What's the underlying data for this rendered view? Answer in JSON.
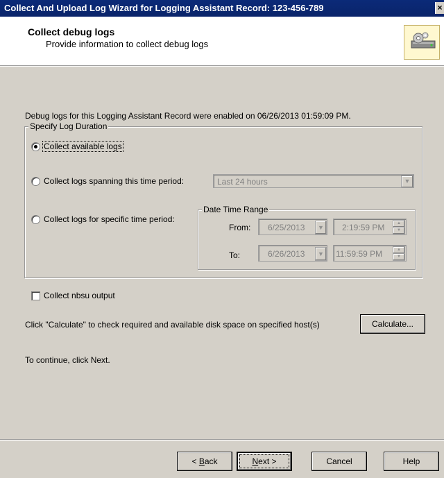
{
  "window": {
    "title": "Collect And Upload Log Wizard for Logging Assistant Record: 123-456-789",
    "close_glyph": "×"
  },
  "header": {
    "title": "Collect debug logs",
    "subtitle": "Provide information to collect debug logs",
    "icon": "gear-server-icon"
  },
  "intro": {
    "text": "Debug logs for this Logging Assistant Record were enabled on 06/26/2013 01:59:09 PM."
  },
  "log_duration": {
    "legend": "Specify Log Duration",
    "options": {
      "available": {
        "label": "Collect available logs",
        "selected": true
      },
      "spanning": {
        "label": "Collect logs spanning this time period:",
        "selected": false
      },
      "specific": {
        "label": "Collect logs for specific time period:",
        "selected": false
      }
    },
    "period_select": {
      "value": "Last 24 hours"
    },
    "date_range": {
      "legend": "Date Time Range",
      "from_label": "From:",
      "from_date": "6/25/2013",
      "from_time": "2:19:59 PM",
      "to_label": "To:",
      "to_date": "6/26/2013",
      "to_time": "11:59:59 PM"
    }
  },
  "nbsu": {
    "label": "Collect nbsu output",
    "checked": false
  },
  "calculate": {
    "text": "Click \"Calculate\" to check required and available disk space on specified host(s)",
    "button": "Calculate..."
  },
  "continue_text": "To continue, click Next.",
  "footer": {
    "back": {
      "pre": "< ",
      "key": "B",
      "rest": "ack"
    },
    "next": {
      "key": "N",
      "rest": "ext >"
    },
    "cancel": "Cancel",
    "help": "Help"
  },
  "colors": {
    "title_bar": "#0a246a",
    "dialog_face": "#d4d0c8",
    "disabled_text": "#808080"
  }
}
